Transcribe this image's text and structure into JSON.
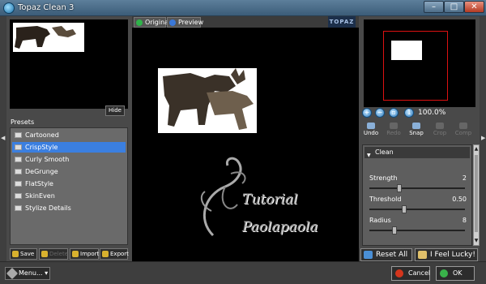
{
  "window": {
    "title": "Topaz Clean 3",
    "minimize": "–",
    "maximize": "□",
    "close": "✕"
  },
  "left_panel": {
    "hide_label": "Hide",
    "presets_label": "Presets",
    "presets": [
      "Cartooned",
      "CrispStyle",
      "Curly Smooth",
      "DeGrunge",
      "FlatStyle",
      "SkinEven",
      "Stylize Details"
    ],
    "selected_preset": "CrispStyle",
    "buttons": {
      "save": "Save",
      "delete": "Delete",
      "import": "Import",
      "export": "Export"
    }
  },
  "center": {
    "tab_original": "Original",
    "tab_preview": "Preview",
    "brand": "TOPAZ",
    "watermark_line1": "Tutorial",
    "watermark_line2": "Paolapaola"
  },
  "right_panel": {
    "zoom": "100.0%",
    "tools": {
      "undo": "Undo",
      "redo": "Redo",
      "snap": "Snap",
      "crop": "Crop",
      "compare": "Comp"
    },
    "section": "Clean",
    "sliders": [
      {
        "label": "Strength",
        "value": "2"
      },
      {
        "label": "Threshold",
        "value": "0.50"
      },
      {
        "label": "Radius",
        "value": "8"
      }
    ],
    "reset_all": "Reset All",
    "feel_lucky": "I Feel Lucky!"
  },
  "statusbar": {
    "menu": "Menu...",
    "cancel": "Cancel",
    "ok": "OK"
  },
  "colors": {
    "selection": "#3b7fe0",
    "nav_frame": "#dd1111",
    "preview_bg": "#000000"
  },
  "icons": [
    "app-icon",
    "folder-icon",
    "zoom-in-icon",
    "zoom-out-icon",
    "undo-icon",
    "redo-icon",
    "snap-icon",
    "wrench-icon",
    "cancel-icon",
    "ok-icon"
  ]
}
